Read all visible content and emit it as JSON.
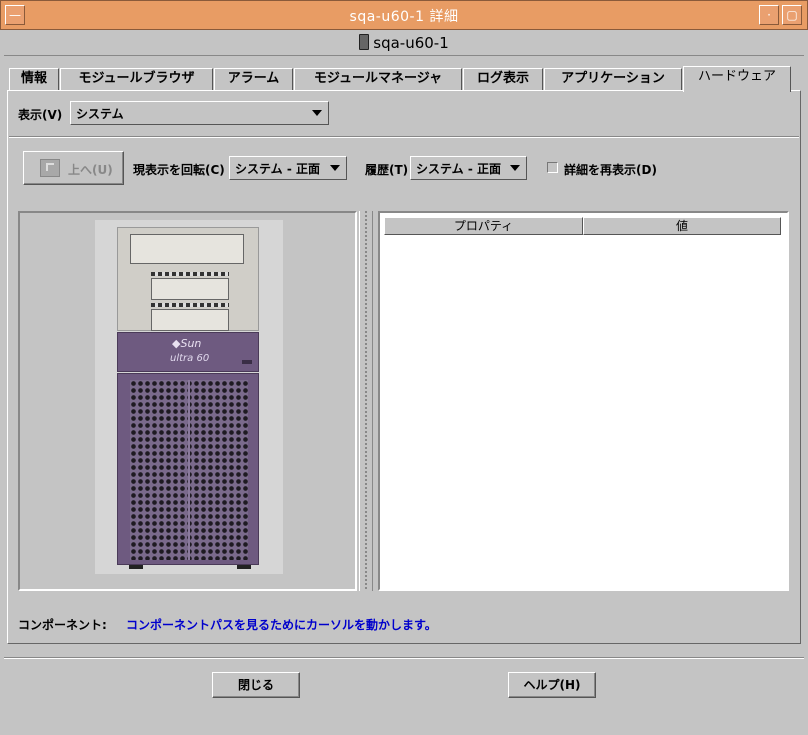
{
  "window": {
    "title": "sqa-u60-1 詳細",
    "host": "sqa-u60-1",
    "menu_glyph": "—",
    "minimize_glyph": "·",
    "maximize_glyph": "▢"
  },
  "tabs": [
    {
      "label": "情報"
    },
    {
      "label": "モジュールブラウザ"
    },
    {
      "label": "アラーム"
    },
    {
      "label": "モジュールマネージャ"
    },
    {
      "label": "ログ表示"
    },
    {
      "label": "アプリケーション"
    },
    {
      "label": "ハードウェア",
      "active": true
    }
  ],
  "view": {
    "label": "表示(V)",
    "selected": "システム"
  },
  "toolbar": {
    "up_label": "上へ(U)",
    "rotate_label": "現表示を回転(C)",
    "rotate_selected": "システム - 正面",
    "history_label": "履歴(T)",
    "history_selected": "システム - 正面",
    "redisplay_label": "詳細を再表示(D)"
  },
  "hardware_image": {
    "brand": "◆Sun",
    "model": "ultra 60"
  },
  "properties_table": {
    "columns": [
      "プロパティ",
      "値"
    ],
    "rows": []
  },
  "component": {
    "label": "コンポーネント:",
    "value": "コンポーネントパスを見るためにカーソルを動かします。",
    "value_color": "#0000cc"
  },
  "footer": {
    "close_label": "閉じる",
    "help_label": "ヘルプ(H)"
  },
  "colors": {
    "title_bar": "#e89c64",
    "background": "#c4c4c4",
    "case_purple": "#6e5a80"
  }
}
